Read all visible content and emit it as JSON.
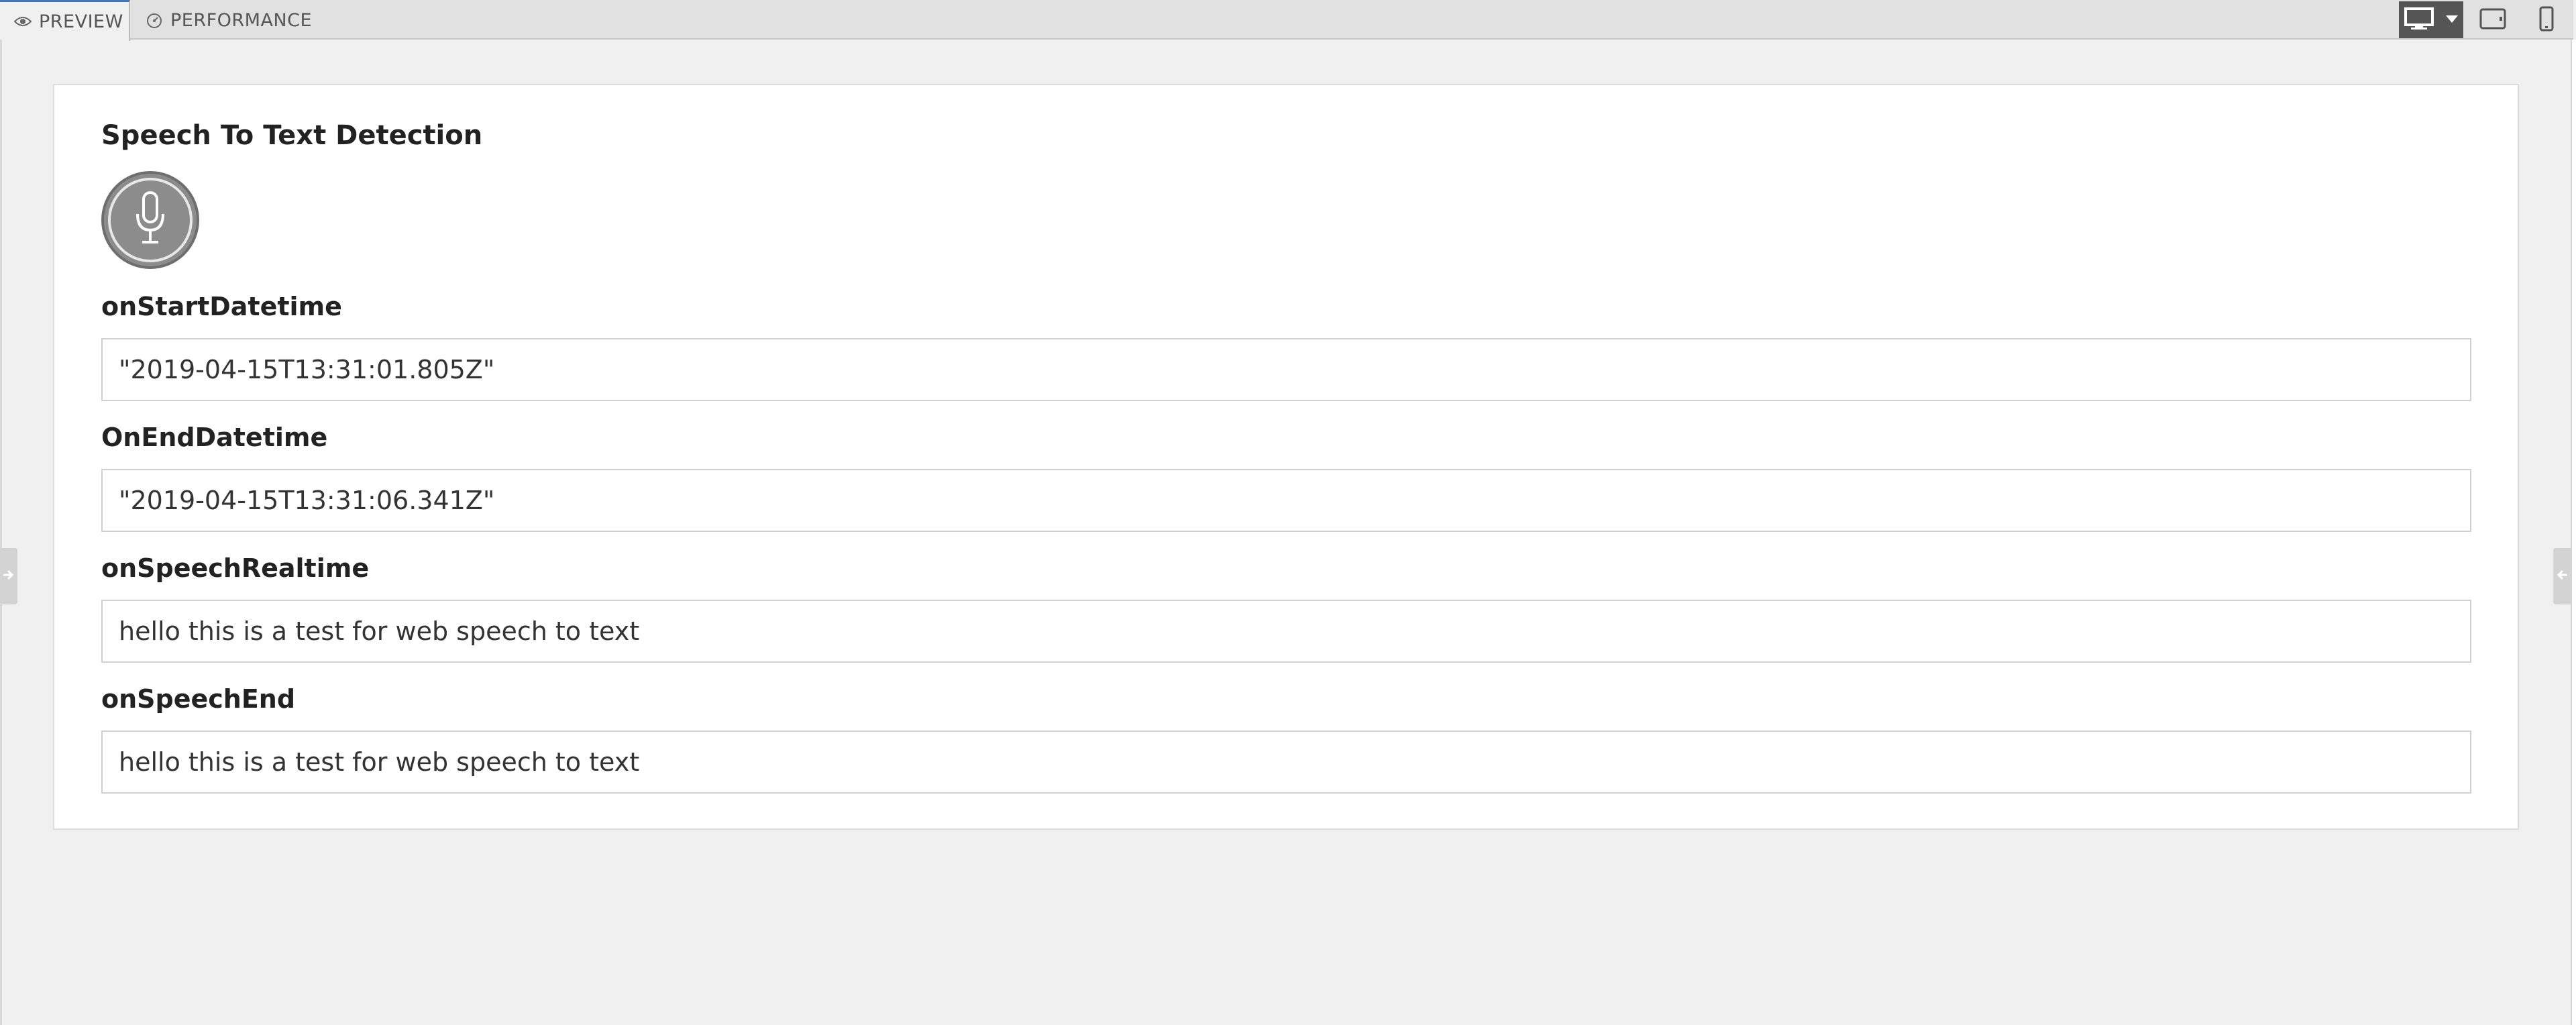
{
  "tabs": [
    {
      "label": "PREVIEW",
      "icon": "eye-icon",
      "active": true
    },
    {
      "label": "PERFORMANCE",
      "icon": "gauge-icon",
      "active": false
    }
  ],
  "device_buttons": [
    {
      "icon": "desktop-icon",
      "selected": true
    },
    {
      "icon": "tablet-icon",
      "selected": false
    },
    {
      "icon": "phone-icon",
      "selected": false
    }
  ],
  "card": {
    "title": "Speech To Text Detection",
    "mic_icon": "microphone-icon",
    "fields": [
      {
        "label": "onStartDatetime",
        "value": "\"2019-04-15T13:31:01.805Z\""
      },
      {
        "label": "OnEndDatetime",
        "value": "\"2019-04-15T13:31:06.341Z\""
      },
      {
        "label": "onSpeechRealtime",
        "value": "hello this is a test for web speech to text"
      },
      {
        "label": "onSpeechEnd",
        "value": "hello this is a test for web speech to text"
      }
    ]
  },
  "colors": {
    "accent_tab_border": "#3c78c2",
    "mic_fill": "#8c8c8c",
    "background": "#f0f0f0"
  }
}
